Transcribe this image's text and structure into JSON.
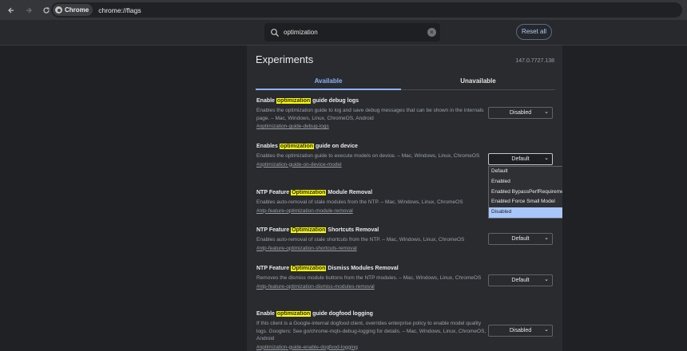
{
  "browser": {
    "chip_label": "Chrome",
    "url": "chrome://flags"
  },
  "header": {
    "search_value": "optimization",
    "reset_label": "Reset all"
  },
  "page": {
    "title": "Experiments",
    "version": "147.0.7727.138",
    "tabs": [
      {
        "label": "Available"
      },
      {
        "label": "Unavailable"
      }
    ]
  },
  "experiments": [
    {
      "pre": "Enable ",
      "hl": "optimization",
      "post": " guide debug logs",
      "desc": "Enables the optimization guide to log and save debug messages that can be shown in the internals page. – Mac, Windows, Linux, ChromeOS, Android",
      "link": "#optimization-guide-debug-logs",
      "select": "Disabled"
    },
    {
      "pre": "Enables ",
      "hl": "optimization",
      "post": " guide on device",
      "desc": "Enables the optimization guide to execute models on device. – Mac, Windows, Linux, ChromeOS",
      "link": "#optimization-guide-on-device-model",
      "select": "Default"
    },
    {
      "pre": "NTP Feature ",
      "hl": "Optimization",
      "post": " Module Removal",
      "desc": "Enables auto-removal of stale modules from the NTP. – Mac, Windows, Linux, ChromeOS",
      "link": "#ntp-feature-optimization-module-removal",
      "select": ""
    },
    {
      "pre": "NTP Feature ",
      "hl": "Optimization",
      "post": " Shortcuts Removal",
      "desc": "Enables auto-removal of stale shortcuts from the NTP. – Mac, Windows, Linux, ChromeOS",
      "link": "#ntp-feature-optimization-shortcuts-removal",
      "select": "Default"
    },
    {
      "pre": "NTP Feature ",
      "hl": "Optimization",
      "post": " Dismiss Modules Removal",
      "desc": "Removes the dismiss module buttons from the NTP modules. – Mac, Windows, Linux, ChromeOS",
      "link": "#ntp-feature-optimization-dismiss-modules-removal",
      "select": "Default"
    },
    {
      "pre": "Enable ",
      "hl": "optimization",
      "post": " guide dogfood logging",
      "desc": "If this client is a Google-internal dogfood client, overrides enterprise policy to enable model quality logs. Googlers: See go/chrome-mqls-debug-logging for details. – Mac, Windows, Linux, ChromeOS, Android",
      "link": "#optimization-guide-enable-dogfood-logging",
      "select": "Disabled"
    }
  ],
  "dropdown": {
    "options": [
      "Default",
      "Enabled",
      "Enabled BypassPerfRequirement",
      "Enabled Force Small Model",
      "Disabled"
    ],
    "highlighted": "Disabled"
  }
}
